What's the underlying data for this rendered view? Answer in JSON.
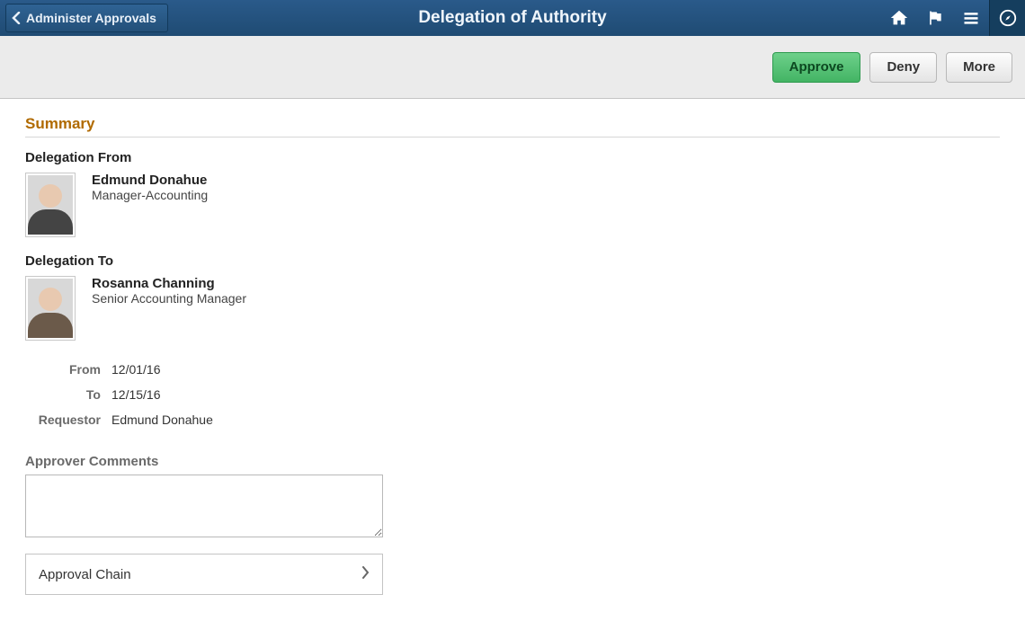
{
  "banner": {
    "back_label": "Administer Approvals",
    "title": "Delegation of Authority"
  },
  "actions": {
    "approve": "Approve",
    "deny": "Deny",
    "more": "More"
  },
  "summary": {
    "heading": "Summary",
    "delegation_from_label": "Delegation From",
    "from_person": {
      "name": "Edmund Donahue",
      "title": "Manager-Accounting"
    },
    "delegation_to_label": "Delegation To",
    "to_person": {
      "name": "Rosanna Channing",
      "title": "Senior Accounting Manager"
    },
    "fields": {
      "from_label": "From",
      "from_value": "12/01/16",
      "to_label": "To",
      "to_value": "12/15/16",
      "requestor_label": "Requestor",
      "requestor_value": "Edmund Donahue"
    },
    "comments_label": "Approver Comments",
    "comments_value": "",
    "approval_chain_label": "Approval Chain"
  }
}
